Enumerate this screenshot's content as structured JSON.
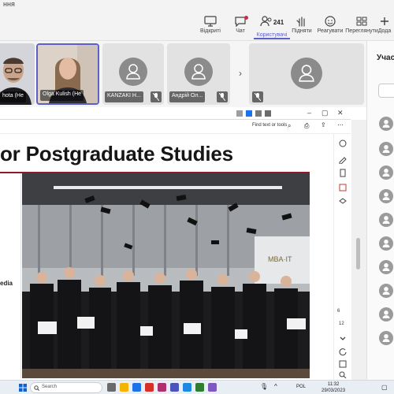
{
  "window": {
    "title_fragment": "ння"
  },
  "toolbar": {
    "items": [
      {
        "label": "Відкриті",
        "icon": "screen-icon"
      },
      {
        "label": "Чат",
        "icon": "chat-icon"
      },
      {
        "label": "Користувачі",
        "icon": "people-icon",
        "count": "241"
      },
      {
        "label": "Підняти",
        "icon": "raise-hand-icon"
      },
      {
        "label": "Реагувати",
        "icon": "emoji-icon"
      },
      {
        "label": "Переглянути",
        "icon": "view-icon"
      },
      {
        "label": "Дода",
        "icon": "add-icon"
      }
    ]
  },
  "participants": [
    {
      "name": "hota (He",
      "camera": true
    },
    {
      "name": "Olga Kulish (He",
      "camera": true
    },
    {
      "name": "KANZAKI H...",
      "camera": false,
      "muted": true
    },
    {
      "name": "Андрій Ол...",
      "camera": false,
      "muted": true
    },
    {
      "name": "",
      "camera": false,
      "muted": true
    }
  ],
  "panel": {
    "title": "Учас"
  },
  "pdf": {
    "find_label": "Find text or tools",
    "page_number": "6",
    "page_count": "12"
  },
  "slide": {
    "title": "or Postgraduate Studies",
    "side_text": "edia",
    "sign_text": "MBA·IT"
  },
  "taskbar": {
    "search_label": "Search",
    "language": "POL",
    "time": "11:32",
    "date": "29/03/2023"
  },
  "colors": {
    "accent": "#5b5fc7",
    "slide_rule": "#8a1b2b",
    "notification": "#c4314b"
  }
}
